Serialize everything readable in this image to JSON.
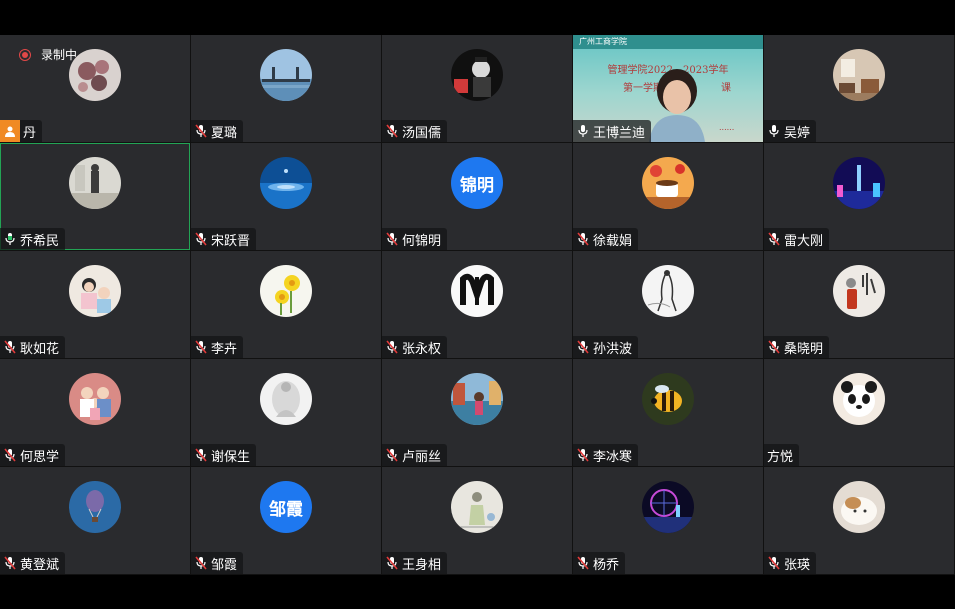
{
  "recording": {
    "label": "录制中"
  },
  "slide": {
    "header": "广州工商学院",
    "line1": "管理学院2022—2023学年",
    "line2": "第一学期",
    "line2_tail": "课",
    "dots": "......"
  },
  "participants": [
    {
      "name": "丹",
      "mic": "user",
      "avatar": "flowers"
    },
    {
      "name": "夏璐",
      "mic": "muted",
      "avatar": "bridge"
    },
    {
      "name": "汤国儒",
      "mic": "muted",
      "avatar": "poster"
    },
    {
      "name": "王博兰迪",
      "mic": "on",
      "avatar": "video"
    },
    {
      "name": "吴婷",
      "mic": "on",
      "avatar": "room"
    },
    {
      "name": "乔希民",
      "mic": "speaking",
      "avatar": "statue"
    },
    {
      "name": "宋跃晋",
      "mic": "muted",
      "avatar": "water"
    },
    {
      "name": "何锦明",
      "mic": "muted",
      "avatar": "text",
      "avatar_text": "锦明",
      "avatar_color": "#1e78f0"
    },
    {
      "name": "徐载娟",
      "mic": "muted",
      "avatar": "cup"
    },
    {
      "name": "雷大刚",
      "mic": "muted",
      "avatar": "tower"
    },
    {
      "name": "耿如花",
      "mic": "muted",
      "avatar": "kids"
    },
    {
      "name": "李卉",
      "mic": "muted",
      "avatar": "daffodil"
    },
    {
      "name": "张永权",
      "mic": "muted",
      "avatar": "letter"
    },
    {
      "name": "孙洪波",
      "mic": "muted",
      "avatar": "sketch"
    },
    {
      "name": "桑晓明",
      "mic": "muted",
      "avatar": "calligraphy"
    },
    {
      "name": "何思学",
      "mic": "muted",
      "avatar": "family"
    },
    {
      "name": "谢保生",
      "mic": "muted",
      "avatar": "figure"
    },
    {
      "name": "卢丽丝",
      "mic": "muted",
      "avatar": "canal"
    },
    {
      "name": "李冰寒",
      "mic": "muted",
      "avatar": "bee"
    },
    {
      "name": "方悦",
      "mic": "none",
      "avatar": "panda"
    },
    {
      "name": "黄登斌",
      "mic": "muted",
      "avatar": "balloon"
    },
    {
      "name": "邹霞",
      "mic": "muted",
      "avatar": "text",
      "avatar_text": "邹霞",
      "avatar_color": "#1e78f0"
    },
    {
      "name": "王身相",
      "mic": "muted",
      "avatar": "sketchman"
    },
    {
      "name": "杨乔",
      "mic": "muted",
      "avatar": "wheel"
    },
    {
      "name": "张瑛",
      "mic": "muted",
      "avatar": "cat"
    }
  ]
}
